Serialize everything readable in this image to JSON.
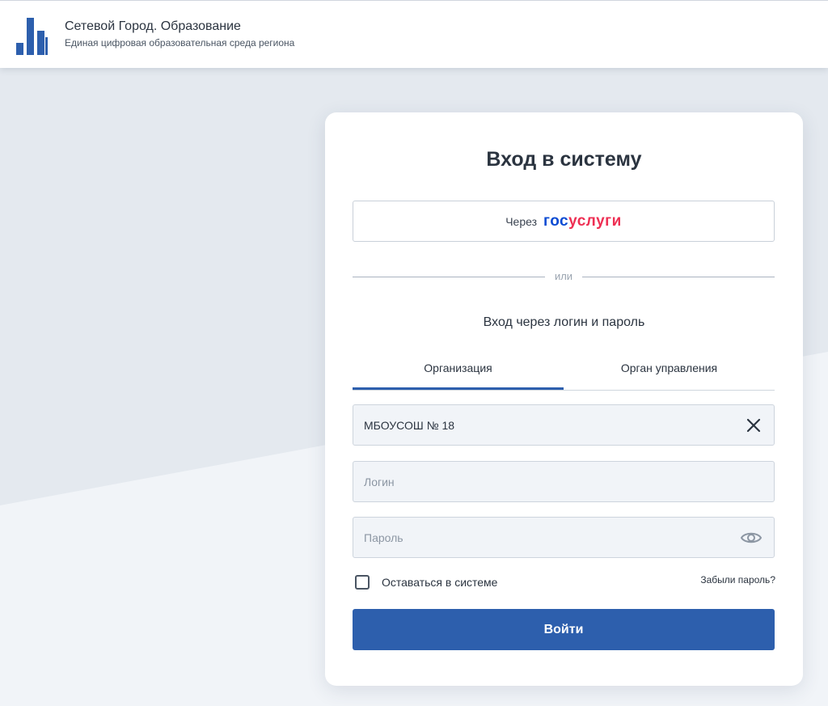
{
  "header": {
    "title": "Сетевой Город. Образование",
    "subtitle": "Единая цифровая образовательная среда региона",
    "logo_icon": "city-buildings-logo"
  },
  "card": {
    "title": "Вход в систему",
    "gosuslugi": {
      "prefix": "Через",
      "logo_part1": "гос",
      "logo_part2": "услуги",
      "color_blue": "#0d4cd3",
      "color_red": "#ee2f53"
    },
    "or_label": "или",
    "login_caption": "Вход через логин и пароль",
    "tabs": [
      {
        "label": "Организация",
        "active": true
      },
      {
        "label": "Орган управления",
        "active": false
      }
    ],
    "organization": {
      "value": "МБОУСОШ № 18",
      "icon": "close-icon"
    },
    "login": {
      "value": "",
      "placeholder": "Логин"
    },
    "password": {
      "value": "",
      "placeholder": "Пароль",
      "icon": "eye-icon"
    },
    "remember": {
      "label": "Оставаться в системе",
      "checked": false
    },
    "forgot_label": "Забыли пароль?",
    "submit_label": "Войти"
  },
  "colors": {
    "accent": "#2d5fad",
    "background": "#e4e9ef",
    "text": "#2b3440"
  }
}
